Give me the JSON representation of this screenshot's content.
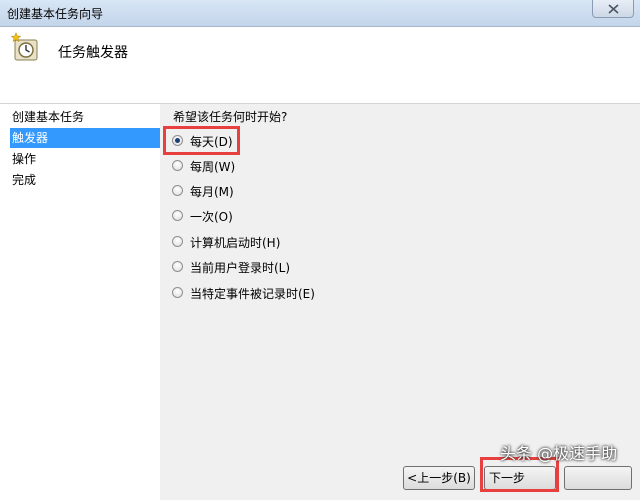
{
  "window": {
    "title": "创建基本任务向导"
  },
  "header": {
    "title": "任务触发器"
  },
  "sidebar": {
    "items": [
      {
        "label": "创建基本任务",
        "active": false
      },
      {
        "label": "触发器",
        "active": true
      },
      {
        "label": "操作",
        "active": false
      },
      {
        "label": "完成",
        "active": false
      }
    ]
  },
  "main": {
    "question": "希望该任务何时开始?",
    "options": [
      {
        "label": "每天(D)",
        "checked": true
      },
      {
        "label": "每周(W)",
        "checked": false
      },
      {
        "label": "每月(M)",
        "checked": false
      },
      {
        "label": "一次(O)",
        "checked": false
      },
      {
        "label": "计算机启动时(H)",
        "checked": false
      },
      {
        "label": "当前用户登录时(L)",
        "checked": false
      },
      {
        "label": "当特定事件被记录时(E)",
        "checked": false
      }
    ]
  },
  "buttons": {
    "back_label": "<上一步(B)",
    "next_label": "下一步"
  },
  "watermark": {
    "text": "头条 @极速手助"
  },
  "colors": {
    "highlight": "#e8403f",
    "selection": "#3399ff"
  }
}
